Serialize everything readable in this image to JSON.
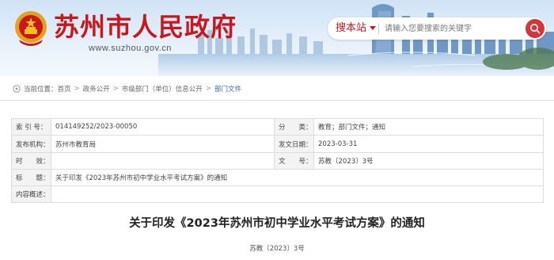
{
  "header": {
    "site_title": "苏州市人民政府",
    "site_url": "www.suzhou.gov.cn",
    "search": {
      "scope_label": "搜本站",
      "placeholder": "请输入您要搜索的关键字"
    },
    "accent_color": "#c8171d"
  },
  "breadcrumb": {
    "prefix": "当前位置：",
    "items": [
      "首页",
      "政务公开",
      "市级部门（单位）信息公开",
      "部门文件"
    ]
  },
  "info_table": {
    "rows": [
      {
        "label": "索 引 号：",
        "value": "014149252/2023-00050",
        "label2": "分　　类：",
        "value2": "教育；部门文件；通知"
      },
      {
        "label": "发布机构：",
        "value": "苏州市教育局",
        "label2": "发文日期：",
        "value2": "2023-03-31"
      },
      {
        "label": "时　　效：",
        "value": "",
        "label2": "文　　号：",
        "value2": "苏教〔2023〕3号"
      },
      {
        "label": "标　　题：",
        "value": "关于印发《2023年苏州市初中学业水平考试方案》的通知"
      },
      {
        "label": "内容概述：",
        "value": ""
      }
    ]
  },
  "article": {
    "title": "关于印发《2023年苏州市初中学业水平考试方案》的通知",
    "doc_number": "苏教〔2023〕3号"
  }
}
